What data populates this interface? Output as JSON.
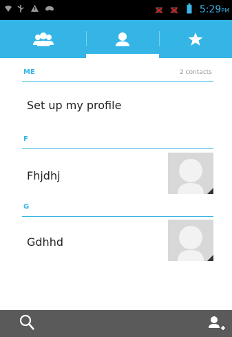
{
  "status_bar": {
    "time": "5:29",
    "ampm": "PM",
    "icons": [
      "wifi-icon",
      "usb-icon",
      "warning-icon",
      "game-controller-icon",
      "no-signal-icon",
      "no-signal-icon",
      "battery-icon"
    ]
  },
  "tabs": [
    {
      "name": "groups",
      "icon": "groups-icon",
      "selected": false
    },
    {
      "name": "contacts",
      "icon": "person-icon",
      "selected": true
    },
    {
      "name": "favorites",
      "icon": "star-icon",
      "selected": false
    }
  ],
  "me_section": {
    "letter": "ME",
    "count": "2 contacts",
    "profile_text": "Set up my profile"
  },
  "sections": [
    {
      "letter": "F",
      "contacts": [
        {
          "name": "Fhjdhj"
        }
      ]
    },
    {
      "letter": "G",
      "contacts": [
        {
          "name": "Gdhhd"
        }
      ]
    }
  ],
  "bottom_bar": {
    "search_icon": "search-icon",
    "add_contact_icon": "add-person-icon"
  },
  "colors": {
    "accent": "#35b5e5",
    "status_bar": "#000000",
    "bottom_bar": "#5a5a5a"
  }
}
